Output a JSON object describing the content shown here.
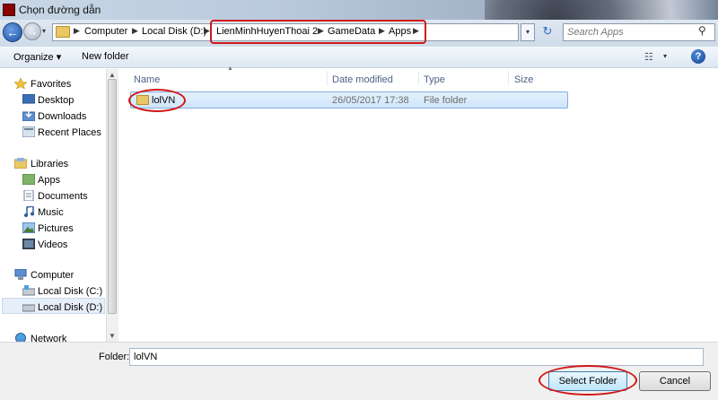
{
  "window": {
    "title": "Chọn đường dẫn"
  },
  "address": {
    "crumbs": [
      "Computer",
      "Local Disk (D:)",
      "LienMinhHuyenThoai 2",
      "GameData",
      "Apps"
    ]
  },
  "search": {
    "placeholder": "Search Apps"
  },
  "toolbar": {
    "organize": "Organize ▾",
    "new_folder": "New folder"
  },
  "nav": {
    "favorites": "Favorites",
    "desktop": "Desktop",
    "downloads": "Downloads",
    "recent": "Recent Places",
    "libraries": "Libraries",
    "apps": "Apps",
    "documents": "Documents",
    "music": "Music",
    "pictures": "Pictures",
    "videos": "Videos",
    "computer": "Computer",
    "disk_c": "Local Disk (C:)",
    "disk_d": "Local Disk (D:)",
    "network": "Network"
  },
  "columns": {
    "name": "Name",
    "date": "Date modified",
    "type": "Type",
    "size": "Size"
  },
  "rows": [
    {
      "name": "lolVN",
      "date": "26/05/2017 17:38",
      "type": "File folder",
      "size": ""
    }
  ],
  "bottom": {
    "folder_label": "Folder:",
    "folder_value": "lolVN",
    "select_label": "Select Folder",
    "cancel_label": "Cancel"
  },
  "colors": {
    "highlight": "#d01818",
    "selection": "#cfe5fb"
  }
}
